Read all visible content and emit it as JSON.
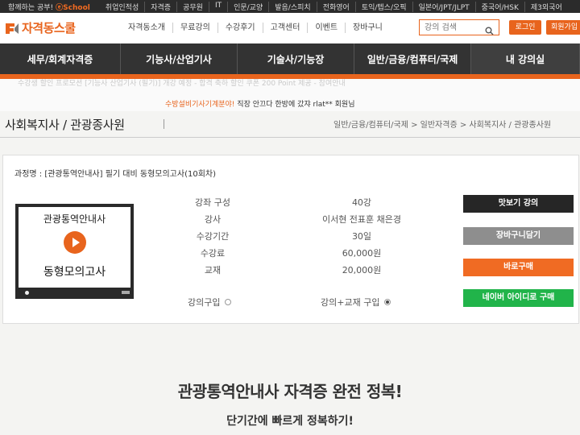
{
  "top_bar": {
    "slogan": "함께하는 공부!",
    "brand": "ⓔSchool",
    "links": [
      "취업인적성",
      "자격증",
      "공무원",
      "IT",
      "인문/교양",
      "발음/스피치",
      "전화영어",
      "토익/텝스/오픽",
      "일본어/JPT/JLPT",
      "중국어/HSK",
      "제3외국어"
    ]
  },
  "header": {
    "logo_text": "자격동스쿨",
    "nav": [
      "자격동소개",
      "무료강의",
      "수강후기",
      "고객센터",
      "이벤트",
      "장바구니"
    ],
    "search_placeholder": "강의 검색",
    "login_label": "로그인",
    "join_label": "회원가입"
  },
  "category_nav": [
    "세무/회계자격증",
    "기능사/산업기사",
    "기술사/기능장",
    "일반/금융/컴퓨터/국제",
    "내 강의실"
  ],
  "ticker": {
    "line1": "수강생 할인 프로모션 [기능사 산업기사 (필기)] 개강 예정 - 합격 축하 할인 쿠폰 200 Point 제공 - 참여안내",
    "line2_highlight": "수방설비기사기계분야!",
    "line2_rest": " 직장 안끄다 한방에 갔쟈 rlat** 회원님"
  },
  "page": {
    "title": "사회복지사 / 관광종사원",
    "breadcrumb": "일반/금융/컴퓨터/국제 > 일반자격증 > 사회복지사 / 관광종사원"
  },
  "course": {
    "name": "과정명 : [관광통역안내사] 필기 대비 동형모의고사(10회차)",
    "thumbnail": {
      "top_text": "관광통역안내사",
      "bottom_text": "동형모의고사"
    },
    "info": [
      {
        "label": "강좌 구성",
        "value": "40강"
      },
      {
        "label": "강사",
        "value": "이서현 전표훈 채은경"
      },
      {
        "label": "수강기간",
        "value": "30일"
      },
      {
        "label": "수강료",
        "value": "60,000원"
      },
      {
        "label": "교재",
        "value": "20,000원"
      }
    ],
    "options": [
      {
        "label": "강의구입",
        "selected": false
      },
      {
        "label": "강의+교재 구입",
        "selected": true
      }
    ],
    "buttons": {
      "preview": "맛보기 강의",
      "cart": "장바구니담기",
      "buy": "바로구매",
      "naver": "네이버 아이디로 구매"
    }
  },
  "promo": {
    "title": "관광통역안내사 자격증 완전 정복!",
    "subtitle": "단기간에 빠르게 정복하기!"
  },
  "colors": {
    "accent": "#e8641d",
    "nav_bg": "#333333",
    "naver_green": "#21b44a"
  }
}
